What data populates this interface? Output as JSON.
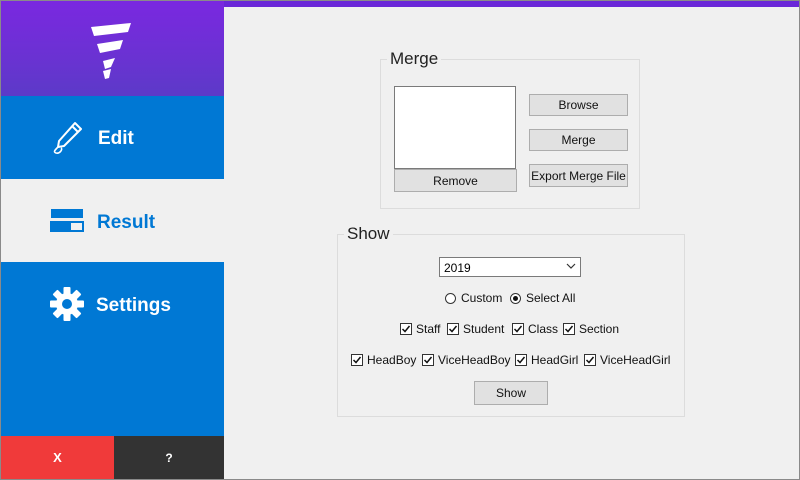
{
  "sidebar": {
    "items": [
      {
        "label": "Edit",
        "icon": "pencil-icon"
      },
      {
        "label": "Result",
        "icon": "list-bars-icon"
      },
      {
        "label": "Settings",
        "icon": "gear-icon"
      }
    ],
    "selected": "Result",
    "close_label": "X",
    "help_label": "?"
  },
  "merge": {
    "title": "Merge",
    "remove_label": "Remove",
    "browse_label": "Browse",
    "merge_label": "Merge",
    "export_label": "Export Merge File"
  },
  "show": {
    "title": "Show",
    "year": "2019",
    "radios": [
      {
        "label": "Custom",
        "checked": false
      },
      {
        "label": "Select All",
        "checked": true
      }
    ],
    "checks_row1": [
      {
        "label": "Staff",
        "checked": true
      },
      {
        "label": "Student",
        "checked": true
      },
      {
        "label": "Class",
        "checked": true
      },
      {
        "label": "Section",
        "checked": true
      }
    ],
    "checks_row2": [
      {
        "label": "HeadBoy",
        "checked": true
      },
      {
        "label": "ViceHeadBoy",
        "checked": true
      },
      {
        "label": "HeadGirl",
        "checked": true
      },
      {
        "label": "ViceHeadGirl",
        "checked": true
      }
    ],
    "show_button": "Show"
  },
  "colors": {
    "sidebar_blue": "#0078d4",
    "header_purple": "#6a27d8",
    "close_red": "#f03a3a",
    "help_dark": "#333333",
    "panel_gray": "#f0f0f0"
  }
}
